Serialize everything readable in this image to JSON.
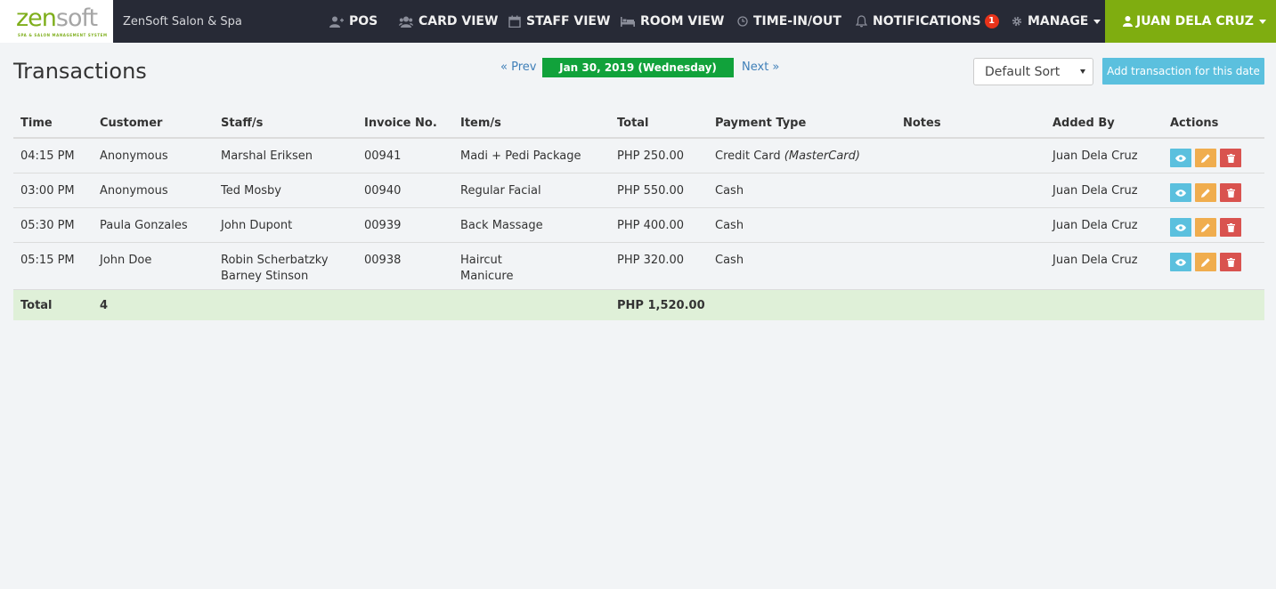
{
  "navbar": {
    "logo": {
      "zen": "zen",
      "soft": "soft",
      "tagline": "SPA & SALON MANAGEMENT SYSTEM"
    },
    "brand_name": "ZenSoft Salon & Spa",
    "items": [
      {
        "label": "POS",
        "icon": "user-plus-icon"
      },
      {
        "label": "CARD VIEW",
        "icon": "users-icon"
      },
      {
        "label": "STAFF VIEW",
        "icon": "calendar-icon"
      },
      {
        "label": "ROOM VIEW",
        "icon": "bed-icon"
      },
      {
        "label": "TIME-IN/OUT",
        "icon": "clock-icon"
      },
      {
        "label": "NOTIFICATIONS",
        "icon": "bell-icon",
        "badge": "1"
      },
      {
        "label": "MANAGE",
        "icon": "gear-icon"
      }
    ],
    "user": {
      "label": "JUAN DELA CRUZ",
      "icon": "user-icon"
    }
  },
  "header": {
    "title": "Transactions",
    "prev_label": "« Prev",
    "date_label": "Jan 30, 2019 (Wednesday)",
    "next_label": "Next »",
    "sort_value": "Default Sort",
    "add_label": "Add transaction for this date"
  },
  "table": {
    "columns": [
      "Time",
      "Customer",
      "Staff/s",
      "Invoice No.",
      "Item/s",
      "Total",
      "Payment Type",
      "Notes",
      "Added By",
      "Actions"
    ],
    "rows": [
      {
        "time": "04:15 PM",
        "customer": "Anonymous",
        "staff": [
          "Marshal Eriksen"
        ],
        "invoice": "00941",
        "items": [
          "Madi + Pedi Package"
        ],
        "total": "PHP 250.00",
        "payment": "Credit Card",
        "payment_detail": "(MasterCard)",
        "notes": "",
        "added_by": "Juan Dela Cruz"
      },
      {
        "time": "03:00 PM",
        "customer": "Anonymous",
        "staff": [
          "Ted Mosby"
        ],
        "invoice": "00940",
        "items": [
          "Regular Facial"
        ],
        "total": "PHP 550.00",
        "payment": "Cash",
        "payment_detail": "",
        "notes": "",
        "added_by": "Juan Dela Cruz"
      },
      {
        "time": "05:30 PM",
        "customer": "Paula Gonzales",
        "staff": [
          "John Dupont"
        ],
        "invoice": "00939",
        "items": [
          "Back Massage"
        ],
        "total": "PHP 400.00",
        "payment": "Cash",
        "payment_detail": "",
        "notes": "",
        "added_by": "Juan Dela Cruz"
      },
      {
        "time": "05:15 PM",
        "customer": "John Doe",
        "staff": [
          "Robin Scherbatzky",
          "Barney Stinson"
        ],
        "invoice": "00938",
        "items": [
          "Haircut",
          "Manicure"
        ],
        "total": "PHP 320.00",
        "payment": "Cash",
        "payment_detail": "",
        "notes": "",
        "added_by": "Juan Dela Cruz"
      }
    ],
    "total_row": {
      "label": "Total",
      "count": "4",
      "total": "PHP 1,520.00"
    }
  },
  "colors": {
    "navbar_bg": "#272a36",
    "user_menu_bg": "#7fad10",
    "date_pill_bg": "#11a23b",
    "view_button": "#5bc0de",
    "edit_button": "#f0ad4e",
    "delete_button": "#d9534f",
    "total_row_bg": "#dff0d8"
  }
}
